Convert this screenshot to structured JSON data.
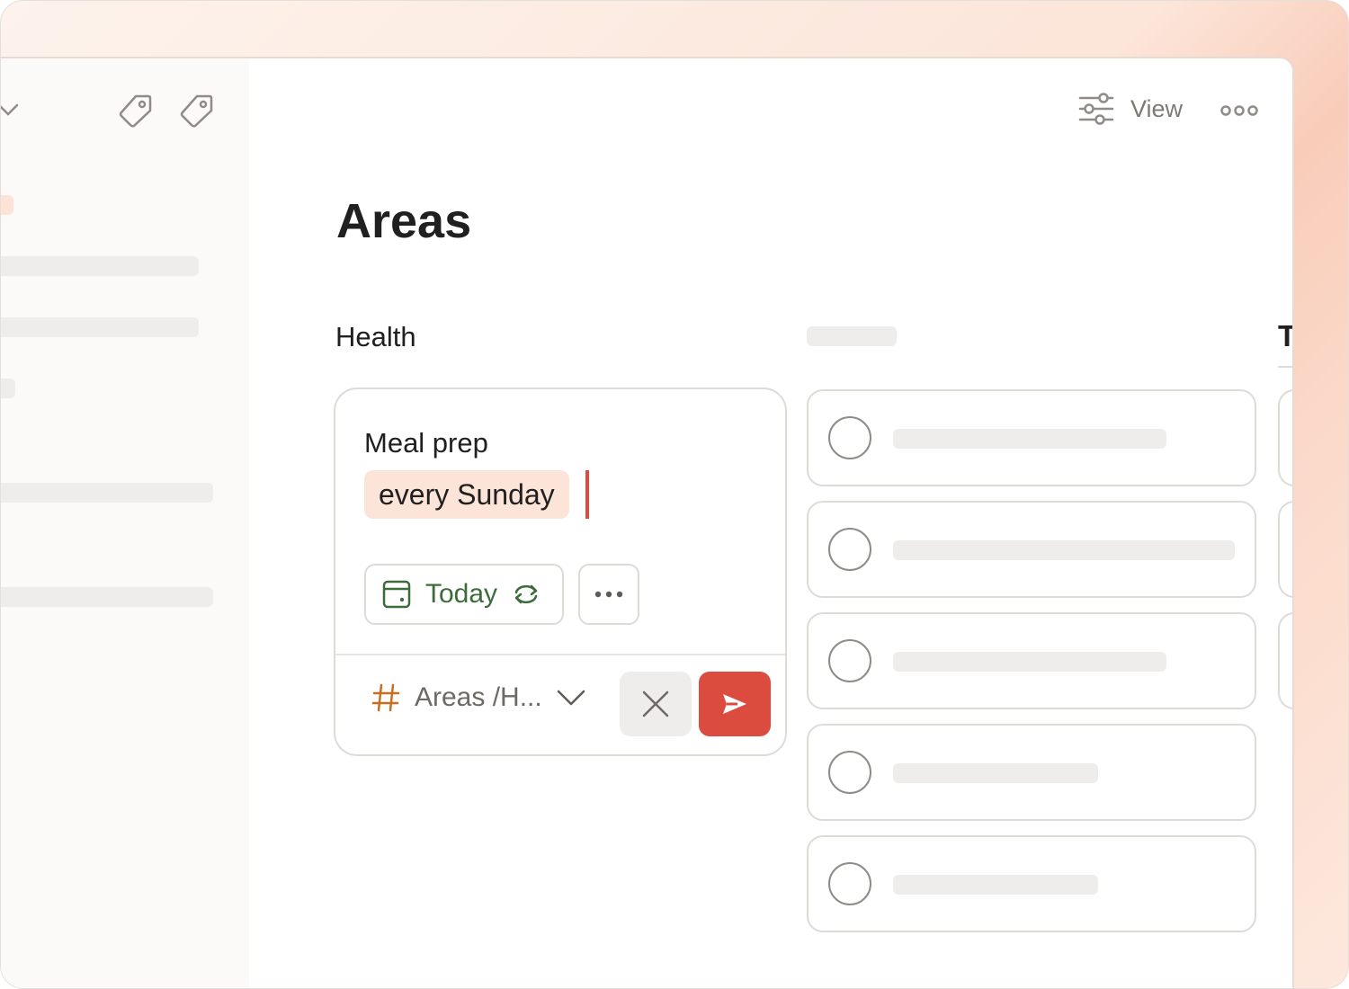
{
  "header": {
    "view_label": "View",
    "icons": [
      "view-settings-icon",
      "more-icon",
      "tag-icon",
      "chevron-down-icon"
    ]
  },
  "page": {
    "title": "Areas"
  },
  "columns": [
    {
      "title": "Health"
    },
    {
      "title": ""
    },
    {
      "title": "T"
    }
  ],
  "editor": {
    "task_name": "Meal prep",
    "recurrence_highlight": "every Sunday",
    "date_label": "Today",
    "project_label": "Areas /H...",
    "accent_color": "#dc4c3e",
    "date_color": "#3d6b3a",
    "project_hash_color": "#c76f1f"
  },
  "task_placeholders": [
    {
      "completed": false
    },
    {
      "completed": false
    },
    {
      "completed": false
    },
    {
      "completed": false
    },
    {
      "completed": false
    }
  ]
}
